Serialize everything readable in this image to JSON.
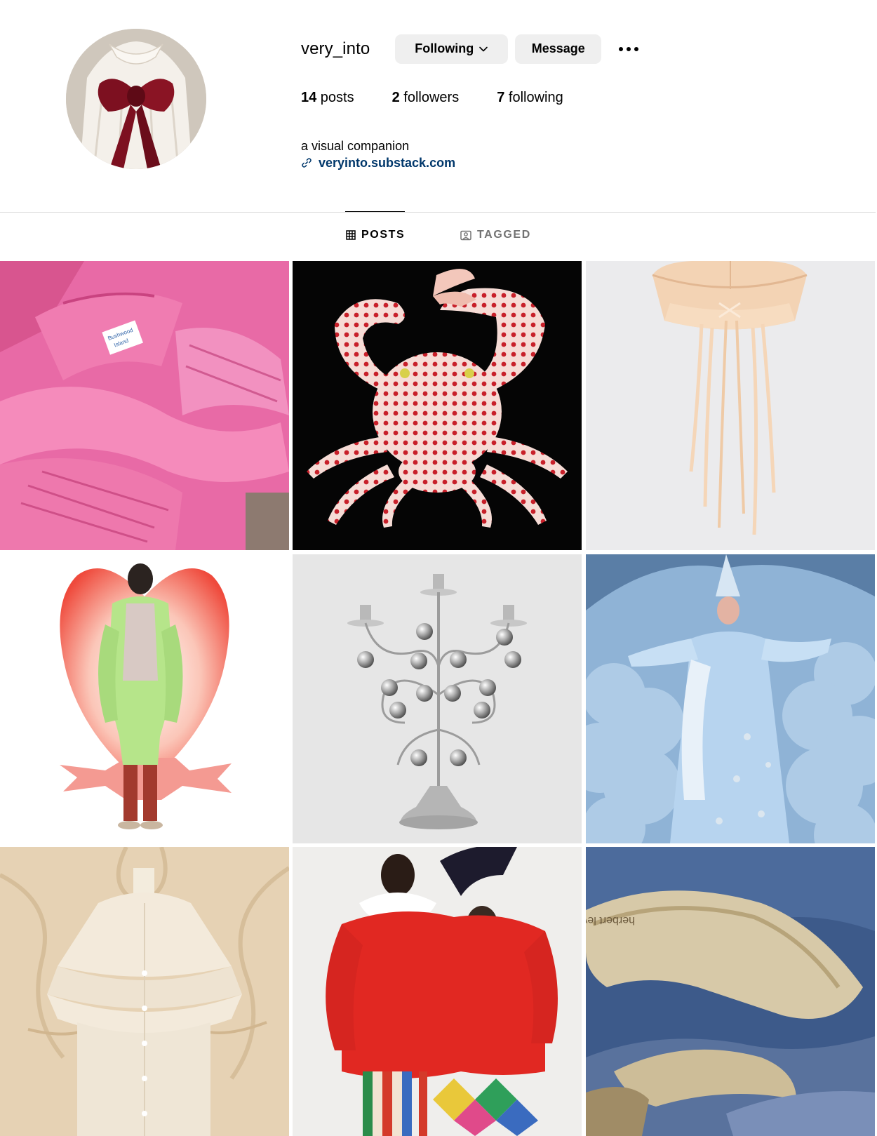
{
  "profile": {
    "username": "very_into",
    "following_button": "Following",
    "message_button": "Message",
    "more_icon": "more-horizontal-icon",
    "avatar_icon": "profile-avatar"
  },
  "stats": {
    "posts_count": "14",
    "posts_label": " posts",
    "followers_count": "2",
    "followers_label": " followers",
    "following_count": "7",
    "following_label": " following"
  },
  "bio": {
    "text": "a visual companion",
    "link": "veryinto.substack.com"
  },
  "tabs": [
    {
      "label": "POSTS",
      "icon": "grid-icon",
      "active": true
    },
    {
      "label": "TAGGED",
      "icon": "tagged-user-icon",
      "active": false
    }
  ],
  "posts": [
    {
      "subject": "pink folded t-shirts"
    },
    {
      "subject": "red-spotted crab on black"
    },
    {
      "subject": "cream satin sailor hat with ribbons"
    },
    {
      "subject": "figure in green coat before red heart"
    },
    {
      "subject": "silver candelabra with ball ornaments"
    },
    {
      "subject": "woman in blue star-spangled robe among clouds"
    },
    {
      "subject": "cream ruffled cardigan on wood panel"
    },
    {
      "subject": "two figures sharing a red sweater"
    },
    {
      "subject": "gold velvet mules"
    }
  ],
  "post_images": {
    "shoe_insole_brand": "herbert levine",
    "tshirt_label": "Bushwood Island"
  },
  "colors": {
    "link": "#00376b",
    "button_bg": "#efefef",
    "divider": "#dbdbdb",
    "inactive_tab": "#737373"
  }
}
